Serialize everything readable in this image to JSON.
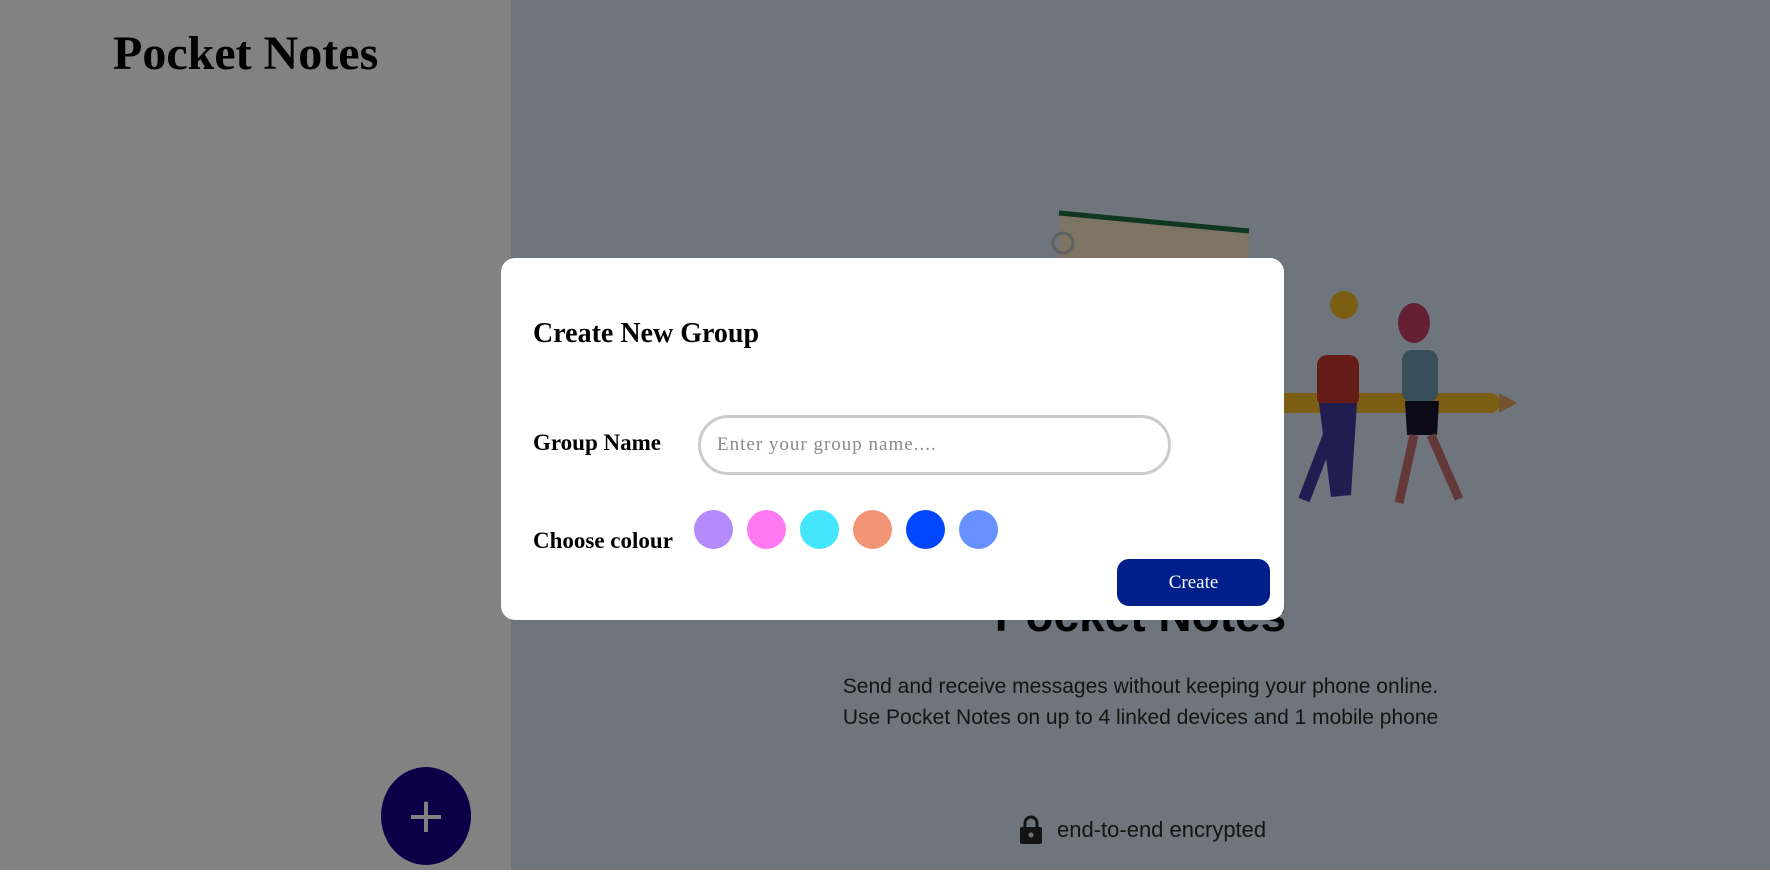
{
  "sidebar": {
    "app_title": "Pocket Notes",
    "add_button_label": "+"
  },
  "main": {
    "hero_title": "Pocket Notes",
    "description_lines": [
      "Send and receive messages without keeping your phone online.",
      "Use Pocket Notes on up to 4 linked devices and 1 mobile phone"
    ],
    "encryption_label": "end-to-end encrypted",
    "icons": {
      "encryption": "lock-icon",
      "illustration": "people-carrying-pencil-illustration"
    }
  },
  "modal": {
    "title": "Create New Group",
    "group_name_label": "Group Name",
    "group_name_value": "",
    "group_name_placeholder": "Enter your group name....",
    "choose_colour_label": "Choose colour",
    "colour_options": [
      "#b38bfa",
      "#ff79f2",
      "#43e6fc",
      "#f19576",
      "#0047ff",
      "#6691ff"
    ],
    "create_button_label": "Create"
  },
  "colors": {
    "sidebar_bg": "#ffffff",
    "main_bg": "#dae5f5",
    "overlay": "rgba(0,0,0,0.49)",
    "fab_bg": "#16008b",
    "create_button_bg": "#001f8b"
  }
}
